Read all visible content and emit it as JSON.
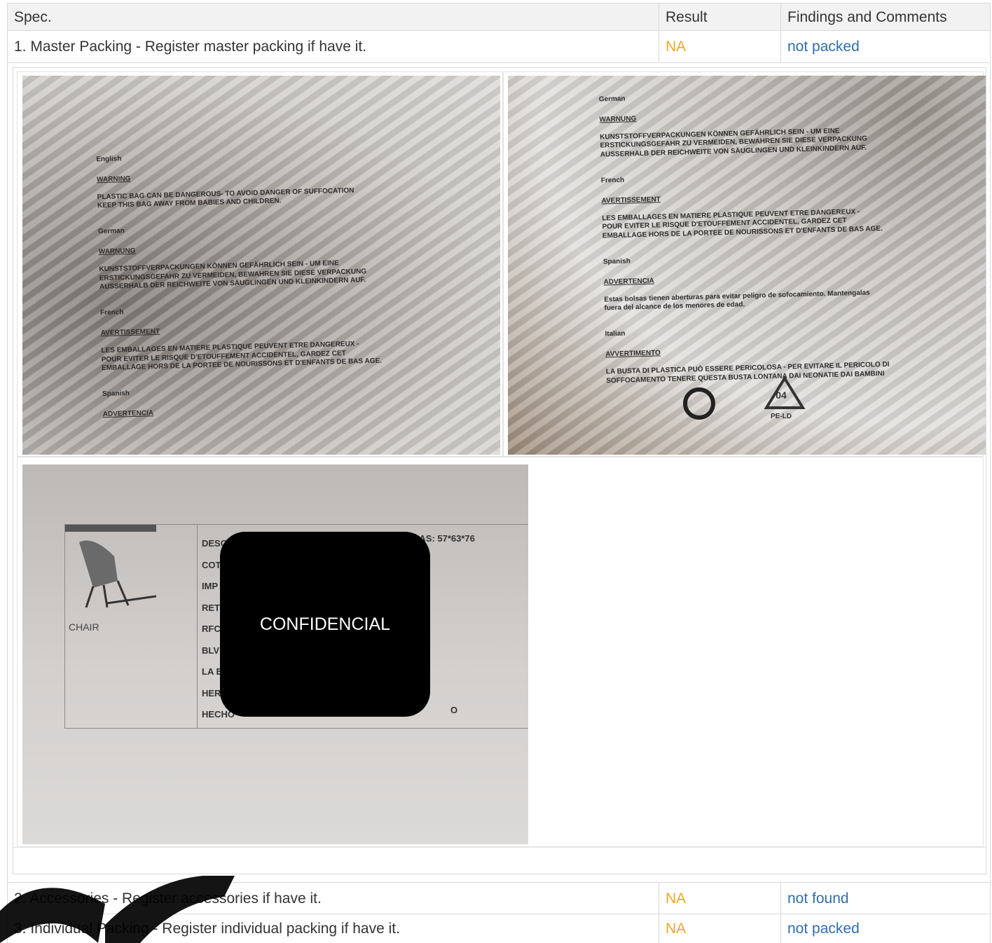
{
  "table": {
    "headers": {
      "spec": "Spec.",
      "result": "Result",
      "comments": "Findings and Comments"
    },
    "rows": [
      {
        "spec": "1. Master Packing - Register master packing if have it.",
        "result": "NA",
        "comment": "not packed"
      },
      {
        "spec": "2. Accessories - Register accessories if have it.",
        "result": "NA",
        "comment": "not found"
      },
      {
        "spec": "3. Individual Packing - Register individual packing if have it.",
        "result": "NA",
        "comment": "not packed"
      }
    ]
  },
  "photos": {
    "left_bag": {
      "lang1": "English",
      "warn1": "WARNING",
      "text1": "PLASTIC BAG CAN BE DANGEROUS- TO AVOID DANGER OF SUFFOCATION\nKEEP THIS BAG AWAY FROM BABIES AND CHILDREN.",
      "lang2": "German",
      "warn2": "WARNUNG",
      "text2": "KUNSTSTOFFVERPACKUNGEN KÖNNEN GEFÄHRLICH SEIN - UM EINE\nERSTICKUNGSGEFAHR ZU VERMEIDEN, BEWAHREN SIE DIESE VERPACKUNG\nAUSSERHALB DER REICHWEITE VON SÄUGLINGEN UND KLEINKINDERN AUF.",
      "lang3": "French",
      "warn3": "AVERTISSEMENT",
      "text3": "LES EMBALLAGES EN MATIERE PLASTIQUE PEUVENT ETRE DANGEREUX -\nPOUR EVITER LE RISQUE D'ETOUFFEMENT ACCIDENTEL, GARDEZ CET\nEMBALLAGE HORS DE LA PORTEE DE NOURISSONS ET D'ENFANTS DE BAS AGE.",
      "lang4": "Spanish",
      "warn4": "ADVERTENCIA"
    },
    "right_bag": {
      "lang1": "German",
      "warn1": "WARNUNG",
      "text1": "KUNSTSTOFFVERPACKUNGEN KÖNNEN GEFÄHRLICH SEIN - UM EINE\nERSTICKUNGSGEFAHR ZU VERMEIDEN, BEWAHREN SIE DIESE VERPACKUNG\nAUSSERHALB DER REICHWEITE VON SÄUGLINGEN UND KLEINKINDERN AUF.",
      "lang2": "French",
      "warn2": "AVERTISSEMENT",
      "text2": "LES EMBALLAGES EN MATIERE PLASTIQUE PEUVENT ETRE DANGEREUX -\nPOUR EVITER LE RISQUE D'ETOUFFEMENT ACCIDENTEL, GARDEZ CET\nEMBALLAGE HORS DE LA PORTEE DE NOURISSONS ET D'ENFANTS DE BAS AGE.",
      "lang3": "Spanish",
      "warn3": "ADVERTENCIA",
      "text3": "Estas bolsas tienen aberturas para evitar peligro de sofocamiento. Mantengalas\nfuera del alcance de los menores de edad.",
      "lang4": "Italian",
      "warn4": "AVVERTIMENTO",
      "text4": "LA BUSTA DI PLASTICA PUÒ ESSERE PERICOLOSA - PER EVITARE IL PERICOLO DI\nSOFFOCAMENTO TENERE QUESTA BUSTA LONTANA DAI NEONATIE DAI BAMBINI",
      "recycle_code": "04",
      "recycle_material": "PE-LD"
    },
    "label": {
      "caption": "CHAIR",
      "line1": "DESCRI",
      "line2": "COT",
      "line3": "IMP",
      "line4": "RET",
      "line5": "RFC:",
      "line6": "BLV",
      "line7": "LA E",
      "line8": "HER",
      "line9": "HECHO",
      "measure": "DIDAS: 57*63*76",
      "tail": "O",
      "redaction": "CONFIDENCIAL"
    }
  }
}
